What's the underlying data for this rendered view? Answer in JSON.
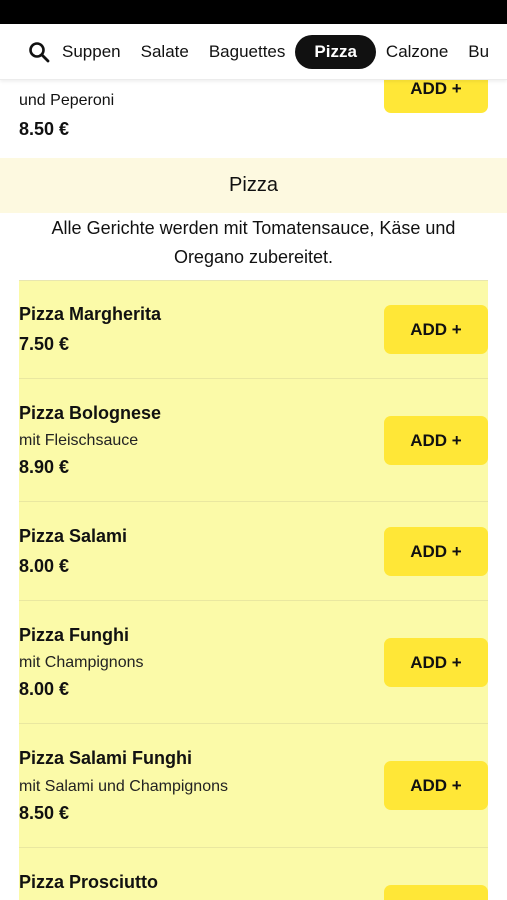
{
  "nav": {
    "categories": [
      {
        "label": "Suppen"
      },
      {
        "label": "Salate"
      },
      {
        "label": "Baguettes"
      },
      {
        "label": "Pizza",
        "active": true
      },
      {
        "label": "Calzone"
      },
      {
        "label": "Bu"
      }
    ]
  },
  "previous_item": {
    "description": "und Peperoni",
    "price": "8.50 €",
    "add_label": "ADD +"
  },
  "section": {
    "title": "Pizza",
    "description": "Alle Gerichte werden mit Tomatensauce, Käse und Oregano zubereitet."
  },
  "items": [
    {
      "name": "Pizza Margherita",
      "description": "",
      "price": "7.50 €",
      "add_label": "ADD +"
    },
    {
      "name": "Pizza Bolognese",
      "description": "mit Fleischsauce",
      "price": "8.90 €",
      "add_label": "ADD +"
    },
    {
      "name": "Pizza Salami",
      "description": "",
      "price": "8.00 €",
      "add_label": "ADD +"
    },
    {
      "name": "Pizza Funghi",
      "description": "mit Champignons",
      "price": "8.00 €",
      "add_label": "ADD +"
    },
    {
      "name": "Pizza Salami Funghi",
      "description": "mit Salami und Champignons",
      "price": "8.50 €",
      "add_label": "ADD +"
    },
    {
      "name": "Pizza Prosciutto",
      "description": "",
      "price": "",
      "add_label": ""
    }
  ],
  "colors": {
    "accent_button": "#ffe737",
    "list_background": "#fbfaa8",
    "section_header_bg": "#fdf9e0",
    "active_tab_bg": "#111111"
  },
  "icons": {
    "search": "search-icon"
  }
}
